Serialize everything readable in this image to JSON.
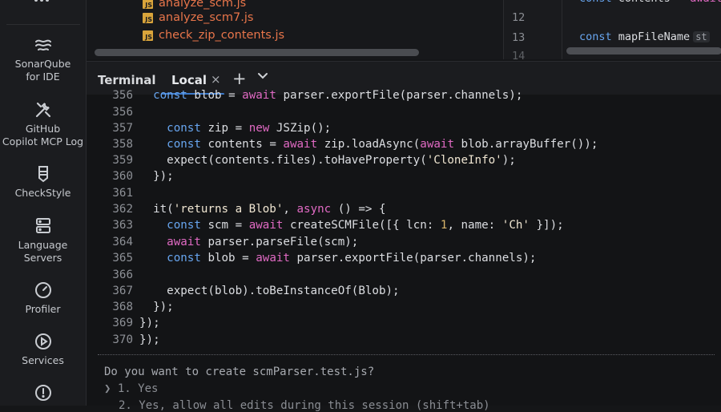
{
  "sidebar": {
    "top_icon": "more-icon",
    "items": [
      {
        "name": "sonarqube",
        "icon": "sonarqube-icon",
        "label1": "SonarQube",
        "label2": "for IDE"
      },
      {
        "name": "github-copilot-mcp",
        "icon": "tools-icon",
        "label1": "GitHub",
        "label2": "Copilot MCP Log"
      },
      {
        "name": "checkstyle",
        "icon": "checkstyle-icon",
        "label1": "CheckStyle",
        "label2": ""
      },
      {
        "name": "language-servers",
        "icon": "server-icon",
        "label1": "Language",
        "label2": "Servers"
      },
      {
        "name": "profiler",
        "icon": "gauge-icon",
        "label1": "Profiler",
        "label2": ""
      },
      {
        "name": "services",
        "icon": "play-circle-icon",
        "label1": "Services",
        "label2": ""
      },
      {
        "name": "problems",
        "icon": "alert-icon",
        "label1": "",
        "label2": ""
      }
    ]
  },
  "project_tree": {
    "files": [
      "analyze_scm.js",
      "analyze_scm7.js",
      "check_zip_contents.js"
    ]
  },
  "editor_top": {
    "lines": [
      {
        "num": "",
        "code": "const contents = await"
      },
      {
        "num": "12",
        "code": ""
      },
      {
        "num": "13",
        "code": "const mapFileName",
        "hint": "st"
      },
      {
        "num": "14",
        "code": ""
      }
    ]
  },
  "terminal": {
    "title": "Terminal",
    "tab_label": "Local",
    "close_glyph": "×",
    "add_glyph": "+",
    "dropdown_glyph": "⌄",
    "resize_glyph": "≑",
    "prompt": "Do you want to create scmParser.test.js?",
    "option1": "❯ 1. Yes",
    "option2": "2. Yes, allow all edits during this session (shift+tab)"
  },
  "colors": {
    "keyword": "#e06ac3",
    "declaration": "#68a6f0",
    "accent": "#3c79c9",
    "file": "#e8754a"
  }
}
